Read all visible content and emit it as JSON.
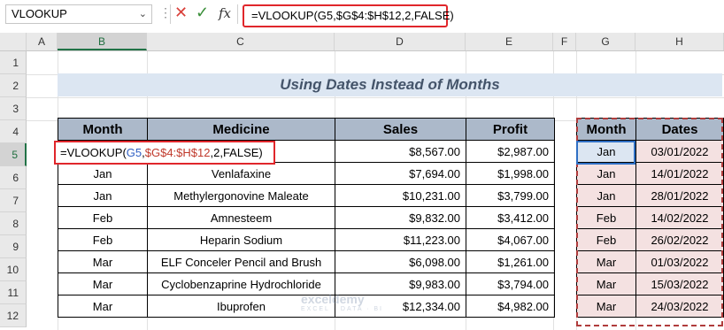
{
  "name_box": {
    "value": "VLOOKUP"
  },
  "formula_bar": {
    "formula": "=VLOOKUP(G5,$G$4:$H$12,2,FALSE)",
    "fx_label": "fx"
  },
  "columns": [
    "A",
    "B",
    "C",
    "D",
    "E",
    "F",
    "G",
    "H"
  ],
  "rows": [
    "1",
    "2",
    "3",
    "4",
    "5",
    "6",
    "7",
    "8",
    "9",
    "10",
    "11",
    "12"
  ],
  "title": "Using Dates Instead of Months",
  "main_table": {
    "headers": [
      "Month",
      "Medicine",
      "Sales",
      "Profit"
    ],
    "edit_cell": {
      "prefix": "=VLOOKUP(",
      "ref1": "G5",
      "comma1": ",",
      "ref2": "$G$4:$H$12",
      "suffix": ",2,FALSE)"
    },
    "rows": [
      {
        "month": "",
        "medicine": "",
        "sales": "$8,567.00",
        "profit": "$2,987.00"
      },
      {
        "month": "Jan",
        "medicine": "Venlafaxine",
        "sales": "$7,694.00",
        "profit": "$1,998.00"
      },
      {
        "month": "Jan",
        "medicine": "Methylergonovine Maleate",
        "sales": "$10,231.00",
        "profit": "$3,799.00"
      },
      {
        "month": "Feb",
        "medicine": "Amnesteem",
        "sales": "$9,832.00",
        "profit": "$3,412.00"
      },
      {
        "month": "Feb",
        "medicine": "Heparin Sodium",
        "sales": "$11,223.00",
        "profit": "$4,067.00"
      },
      {
        "month": "Mar",
        "medicine": "ELF Conceler Pencil and Brush",
        "sales": "$6,098.00",
        "profit": "$1,261.00"
      },
      {
        "month": "Mar",
        "medicine": "Cyclobenzaprine Hydrochloride",
        "sales": "$9,983.00",
        "profit": "$3,794.00"
      },
      {
        "month": "Mar",
        "medicine": "Ibuprofen",
        "sales": "$12,334.00",
        "profit": "$4,982.00"
      }
    ]
  },
  "lookup_table": {
    "headers": [
      "Month",
      "Dates"
    ],
    "rows": [
      {
        "month": "Jan",
        "date": "03/01/2022"
      },
      {
        "month": "Jan",
        "date": "14/01/2022"
      },
      {
        "month": "Jan",
        "date": "28/01/2022"
      },
      {
        "month": "Feb",
        "date": "14/02/2022"
      },
      {
        "month": "Feb",
        "date": "26/02/2022"
      },
      {
        "month": "Mar",
        "date": "01/03/2022"
      },
      {
        "month": "Mar",
        "date": "15/03/2022"
      },
      {
        "month": "Mar",
        "date": "24/03/2022"
      }
    ]
  },
  "watermark": {
    "brand": "exceldemy",
    "tagline": "EXCEL · DATA · BI"
  }
}
